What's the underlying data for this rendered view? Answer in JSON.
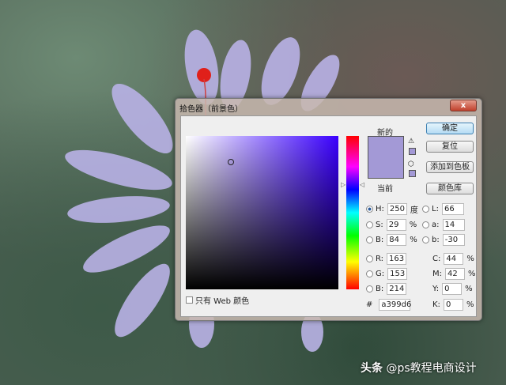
{
  "dialog": {
    "title": "拾色器（前景色）",
    "close_label": "x"
  },
  "preview": {
    "new_label": "新的",
    "current_label": "当前",
    "new_color": "#a399d6",
    "current_color": "#a399d6"
  },
  "buttons": {
    "ok": "确定",
    "reset": "复位",
    "add_swatch": "添加到色板",
    "color_library": "颜色库"
  },
  "hsb": [
    {
      "label": "H:",
      "value": "250",
      "unit": "度",
      "selected": true
    },
    {
      "label": "S:",
      "value": "29",
      "unit": "%"
    },
    {
      "label": "B:",
      "value": "84",
      "unit": "%"
    }
  ],
  "lab": [
    {
      "label": "L:",
      "value": "66"
    },
    {
      "label": "a:",
      "value": "14"
    },
    {
      "label": "b:",
      "value": "-30"
    }
  ],
  "rgb": [
    {
      "label": "R:",
      "value": "163"
    },
    {
      "label": "G:",
      "value": "153"
    },
    {
      "label": "B:",
      "value": "214"
    }
  ],
  "cmyk": [
    {
      "label": "C:",
      "value": "44",
      "unit": "%"
    },
    {
      "label": "M:",
      "value": "42",
      "unit": "%"
    },
    {
      "label": "Y:",
      "value": "0",
      "unit": "%"
    },
    {
      "label": "K:",
      "value": "0",
      "unit": "%"
    }
  ],
  "hex": {
    "label": "#",
    "value": "a399d6"
  },
  "web_only": {
    "label": "只有 Web 颜色",
    "checked": false
  },
  "watermark": {
    "platform": "头条",
    "handle": "@ps教程电商设计"
  }
}
